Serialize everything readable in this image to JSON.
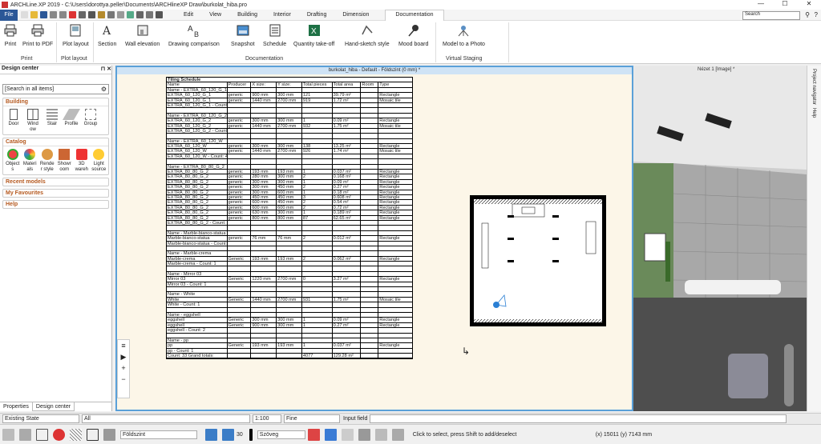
{
  "window": {
    "title": "ARCHLine.XP 2019 - C:\\Users\\dorottya.peller\\Documents\\ARCHlineXP Draw\\burkolat_hiba.pro"
  },
  "menu": {
    "file": "File",
    "tabs": [
      "Edit",
      "View",
      "Building",
      "Interior",
      "Drafting",
      "Dimension",
      "Documentation"
    ],
    "search_placeholder": "Search"
  },
  "ribbon": {
    "buttons": [
      {
        "label": "Print"
      },
      {
        "label": "Print to PDF"
      },
      {
        "label": "Plot layout"
      },
      {
        "label": "Section"
      },
      {
        "label": "Wall elevation"
      },
      {
        "label": "Drawing comparison"
      },
      {
        "label": "Snapshot"
      },
      {
        "label": "Schedule"
      },
      {
        "label": "Quantity take-off"
      },
      {
        "label": "Hand-sketch style"
      },
      {
        "label": "Mood board"
      },
      {
        "label": "Model to a Photo"
      }
    ],
    "groups": [
      "Print",
      "Plot layout",
      "Documentation",
      "Virtual Staging"
    ]
  },
  "left_panel": {
    "title": "Design center",
    "search": "[Search in all items]",
    "building": {
      "header": "Building",
      "items": [
        "Door",
        "Wind ow",
        "Stair",
        "Profile",
        "Group"
      ]
    },
    "catalog": {
      "header": "Catalog",
      "items": [
        "Object s",
        "Materi als",
        "Rende r style",
        "Showr oom",
        "3D wareh",
        "Light source"
      ]
    },
    "links": [
      "Recent models",
      "My Favourites",
      "Help"
    ],
    "tabs": [
      "Properties",
      "Design center"
    ]
  },
  "main_window": {
    "title": "burkolat_hiba - Default - Földszint (0 mm) *"
  },
  "right_window": {
    "title": "Nézet 1 [Image] *",
    "side_tabs": [
      "Project navigator",
      "Help"
    ]
  },
  "schedule": {
    "title": "Tiling Schedule",
    "headers": [
      "Name",
      "Producer",
      "X size:",
      "Y size:",
      "Total pieces",
      "Total area",
      "Room",
      "Type"
    ],
    "rows": [
      [
        "Name - EXTRA_60_120_G_1",
        "",
        "",
        "",
        "",
        "",
        "",
        ""
      ],
      [
        "EXTRA_60_120_G_1",
        "generic",
        "900 mm",
        "300 mm",
        "121",
        "39.79 m²",
        "",
        "Rectangle"
      ],
      [
        "EXTRA_60_120_G_1",
        "generic",
        "1440 mm",
        "2700 mm",
        "919",
        "1.72 m²",
        "",
        "Mosaic tile"
      ],
      [
        "EXTRA_60_120_G_1 - Count: 4",
        "",
        "",
        "",
        "",
        "",
        "",
        ""
      ],
      [
        "",
        "",
        "",
        "",
        "",
        "",
        "",
        ""
      ],
      [
        "Name - EXTRA_60_120_G_2",
        "",
        "",
        "",
        "",
        "",
        "",
        ""
      ],
      [
        "EXTRA_60_120_G_2",
        "generic",
        "300 mm",
        "300 mm",
        "1",
        "0.09 m²",
        "",
        "Rectangle"
      ],
      [
        "EXTRA_60_120_G_2",
        "generic",
        "1440 mm",
        "2700 mm",
        "932",
        "1.75 m²",
        "",
        "Mosaic tile"
      ],
      [
        "EXTRA_60_120_G_2 - Count: 2",
        "",
        "",
        "",
        "",
        "",
        "",
        ""
      ],
      [
        "",
        "",
        "",
        "",
        "",
        "",
        "",
        ""
      ],
      [
        "Name - EXTRA_60_120_W",
        "",
        "",
        "",
        "",
        "",
        "",
        ""
      ],
      [
        "EXTRA_60_120_W",
        "generic",
        "300 mm",
        "300 mm",
        "138",
        "13.25 m²",
        "",
        "Rectangle"
      ],
      [
        "EXTRA_60_120_W",
        "generic",
        "1440 mm",
        "2700 mm",
        "926",
        "1.74 m²",
        "",
        "Mosaic tile"
      ],
      [
        "EXTRA_60_120_W - Count: 4",
        "",
        "",
        "",
        "",
        "",
        "",
        ""
      ],
      [
        "",
        "",
        "",
        "",
        "",
        "",
        "",
        ""
      ],
      [
        "Name - EXTRA_80_80_G_2",
        "",
        "",
        "",
        "",
        "",
        "",
        ""
      ],
      [
        "EXTRA_80_80_G_2",
        "generic",
        "193 mm",
        "193 mm",
        "1",
        "0.037 m²",
        "",
        "Rectangle"
      ],
      [
        "EXTRA_80_80_G_2",
        "generic",
        "280 mm",
        "300 mm",
        "2",
        "0.168 m²",
        "",
        "Rectangle"
      ],
      [
        "EXTRA_80_80_G_2",
        "generic",
        "300 mm",
        "300 mm",
        "1",
        "0.09 m²",
        "",
        "Rectangle"
      ],
      [
        "EXTRA_80_80_G_2",
        "generic",
        "300 mm",
        "450 mm",
        "2",
        "0.27 m²",
        "",
        "Rectangle"
      ],
      [
        "EXTRA_80_80_G_2",
        "generic",
        "300 mm",
        "600 mm",
        "1",
        "0.18 m²",
        "",
        "Rectangle"
      ],
      [
        "EXTRA_80_80_G_2",
        "generic",
        "450 mm",
        "450 mm",
        "3",
        "0.608 m²",
        "",
        "Rectangle"
      ],
      [
        "EXTRA_80_80_G_2",
        "generic",
        "600 mm",
        "450 mm",
        "2",
        "0.54 m²",
        "",
        "Rectangle"
      ],
      [
        "EXTRA_80_80_G_2",
        "generic",
        "600 mm",
        "600 mm",
        "2",
        "0.72 m²",
        "",
        "Rectangle"
      ],
      [
        "EXTRA_80_80_G_2",
        "generic",
        "630 mm",
        "300 mm",
        "1",
        "0.189 m²",
        "",
        "Rectangle"
      ],
      [
        "EXTRA_80_80_G_2",
        "generic",
        "800 mm",
        "800 mm",
        "87",
        "62.65 m²",
        "",
        "Rectangle"
      ],
      [
        "EXTRA_80_80_G_2 - Count: 16",
        "",
        "",
        "",
        "",
        "",
        "",
        ""
      ],
      [
        "",
        "",
        "",
        "",
        "",
        "",
        "",
        ""
      ],
      [
        "Name - Marble-bianco-statua",
        "",
        "",
        "",
        "",
        "",
        "",
        ""
      ],
      [
        "Marble-bianco-statua",
        "generic",
        "76 mm",
        "76 mm",
        "2",
        "0.012 m²",
        "",
        "Rectangle"
      ],
      [
        "Marble-bianco-statua - Count: 1",
        "",
        "",
        "",
        "",
        "",
        "",
        ""
      ],
      [
        "",
        "",
        "",
        "",
        "",
        "",
        "",
        ""
      ],
      [
        "Name - Marble-crema",
        "",
        "",
        "",
        "",
        "",
        "",
        ""
      ],
      [
        "Marble-crema",
        "Generic",
        "193 mm",
        "193 mm",
        "2",
        "0.062 m²",
        "",
        "Rectangle"
      ],
      [
        "Marble-crema - Count: 1",
        "",
        "",
        "",
        "",
        "",
        "",
        ""
      ],
      [
        "",
        "",
        "",
        "",
        "",
        "",
        "",
        ""
      ],
      [
        "Name - Mirror 03",
        "",
        "",
        "",
        "",
        "",
        "",
        ""
      ],
      [
        "Mirror 03",
        "Generic",
        "1220 mm",
        "2700 mm",
        "0",
        "3.27 m²",
        "",
        "Rectangle"
      ],
      [
        "Mirror 03 - Count: 1",
        "",
        "",
        "",
        "",
        "",
        "",
        ""
      ],
      [
        "",
        "",
        "",
        "",
        "",
        "",
        "",
        ""
      ],
      [
        "Name - White",
        "",
        "",
        "",
        "",
        "",
        "",
        ""
      ],
      [
        "White",
        "Generic",
        "1440 mm",
        "2700 mm",
        "931",
        "1.75 m²",
        "",
        "Mosaic tile"
      ],
      [
        "White - Count: 1",
        "",
        "",
        "",
        "",
        "",
        "",
        ""
      ],
      [
        "",
        "",
        "",
        "",
        "",
        "",
        "",
        ""
      ],
      [
        "Name - eggshell",
        "",
        "",
        "",
        "",
        "",
        "",
        ""
      ],
      [
        "eggshell",
        "Generic",
        "300 mm",
        "300 mm",
        "1",
        "0.09 m²",
        "",
        "Rectangle"
      ],
      [
        "eggshell",
        "Generic",
        "900 mm",
        "300 mm",
        "1",
        "0.27 m²",
        "",
        "Rectangle"
      ],
      [
        "eggshell - Count: 2",
        "",
        "",
        "",
        "",
        "",
        "",
        ""
      ],
      [
        "",
        "",
        "",
        "",
        "",
        "",
        "",
        ""
      ],
      [
        "Name - pp",
        "",
        "",
        "",
        "",
        "",
        "",
        ""
      ],
      [
        "pp",
        "Generic",
        "193 mm",
        "193 mm",
        "1",
        "0.037 m²",
        "",
        "Rectangle"
      ],
      [
        "pp - Count: 1",
        "",
        "",
        "",
        "",
        "",
        "",
        ""
      ],
      [
        "Count: 33 Grand totals:",
        "",
        "",
        "",
        "4077",
        "129.28 m²",
        "",
        ""
      ]
    ]
  },
  "status": {
    "layer_state": "Existing State",
    "all": "All",
    "scale": "1:100",
    "line": "Fine",
    "input_label": "Input field",
    "floor": "Földszint",
    "num": "30",
    "text_style": "Szöveg",
    "hint": "Click to select, press Shift to add/deselect",
    "coords": "(x) 15011  (y) 7143 mm"
  },
  "colors": {
    "accent": "#2b5797",
    "category": "#b5591f",
    "window_border": "#5aa0d8",
    "paper": "#fcf6e8"
  }
}
